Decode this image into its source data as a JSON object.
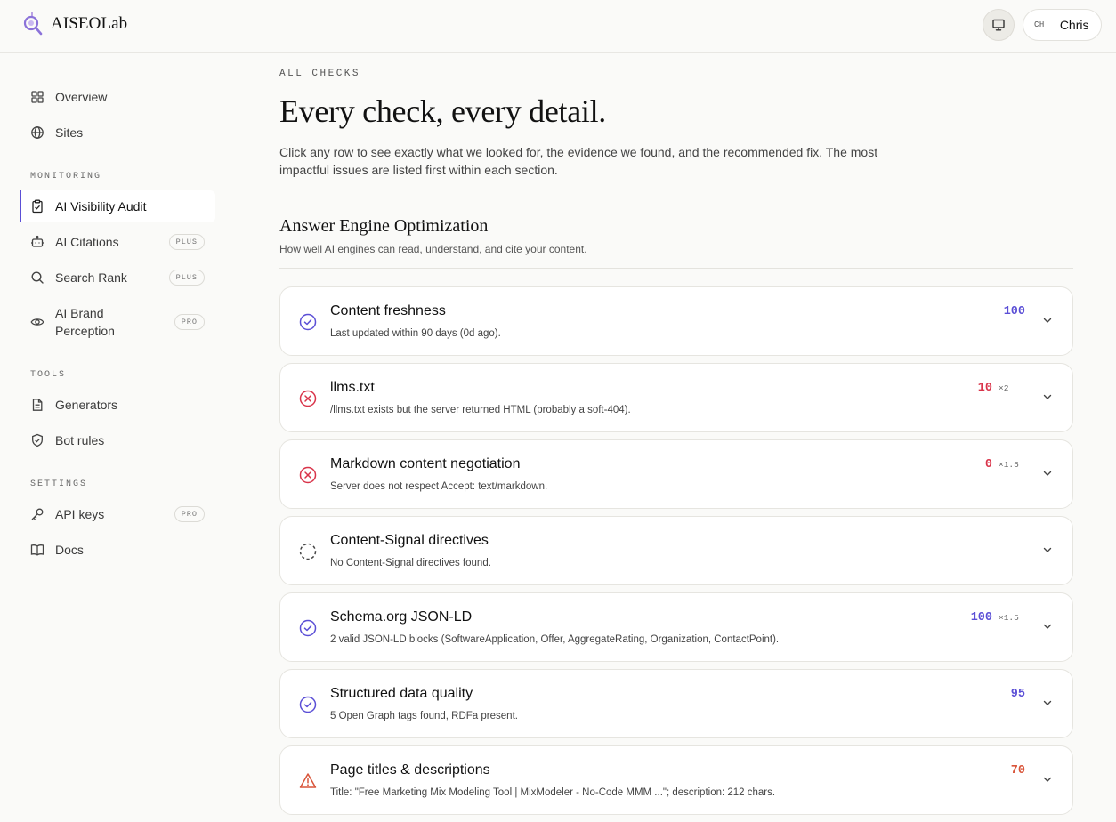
{
  "header": {
    "brand": "AISEOLab",
    "user_initials": "CH",
    "user_name": "Chris",
    "icons": {
      "logo": "magnifier-logo-icon",
      "monitor": "monitor-icon"
    }
  },
  "sidebar": {
    "top_items": [
      {
        "label": "Overview",
        "icon": "grid-icon"
      },
      {
        "label": "Sites",
        "icon": "globe-icon"
      }
    ],
    "monitoring_label": "MONITORING",
    "monitoring_items": [
      {
        "label": "AI Visibility Audit",
        "icon": "clipboard-check-icon",
        "active": true
      },
      {
        "label": "AI Citations",
        "icon": "bot-icon",
        "badge": "PLUS"
      },
      {
        "label": "Search Rank",
        "icon": "search-icon",
        "badge": "PLUS"
      },
      {
        "label": "AI Brand Perception",
        "icon": "eye-icon",
        "badge": "PRO"
      }
    ],
    "tools_label": "TOOLS",
    "tools_items": [
      {
        "label": "Generators",
        "icon": "file-text-icon"
      },
      {
        "label": "Bot rules",
        "icon": "shield-check-icon"
      }
    ],
    "settings_label": "SETTINGS",
    "settings_items": [
      {
        "label": "API keys",
        "icon": "key-icon",
        "badge": "PRO"
      },
      {
        "label": "Docs",
        "icon": "book-icon"
      }
    ]
  },
  "main": {
    "eyebrow": "ALL CHECKS",
    "title": "Every check, every detail.",
    "description": "Click any row to see exactly what we looked for, the evidence we found, and the recommended fix. The most impactful issues are listed first within each section.",
    "section": {
      "title": "Answer Engine Optimization",
      "subtitle": "How well AI engines can read, understand, and cite your content."
    },
    "checks": [
      {
        "title": "Content freshness",
        "desc": "Last updated within 90 days (0d ago).",
        "score": "100",
        "mult": "",
        "status": "pass"
      },
      {
        "title": "llms.txt",
        "desc": "/llms.txt exists but the server returned HTML (probably a soft-404).",
        "score": "10",
        "mult": "×2",
        "status": "fail"
      },
      {
        "title": "Markdown content negotiation",
        "desc": "Server does not respect Accept: text/markdown.",
        "score": "0",
        "mult": "×1.5",
        "status": "fail"
      },
      {
        "title": "Content-Signal directives",
        "desc": "No Content-Signal directives found.",
        "score": "",
        "mult": "",
        "status": "na"
      },
      {
        "title": "Schema.org JSON-LD",
        "desc": "2 valid JSON-LD blocks (SoftwareApplication, Offer, AggregateRating, Organization, ContactPoint).",
        "score": "100",
        "mult": "×1.5",
        "status": "pass"
      },
      {
        "title": "Structured data quality",
        "desc": "5 Open Graph tags found, RDFa present.",
        "score": "95",
        "mult": "",
        "status": "pass"
      },
      {
        "title": "Page titles & descriptions",
        "desc": "Title: \"Free Marketing Mix Modeling Tool | MixModeler - No-Code MMM ...\"; description: 212 chars.",
        "score": "70",
        "mult": "",
        "status": "warn"
      }
    ],
    "colors": {
      "pass": "#5b4fd6",
      "fail": "#d9344a",
      "warn": "#d9553a",
      "na": "#444444"
    }
  }
}
